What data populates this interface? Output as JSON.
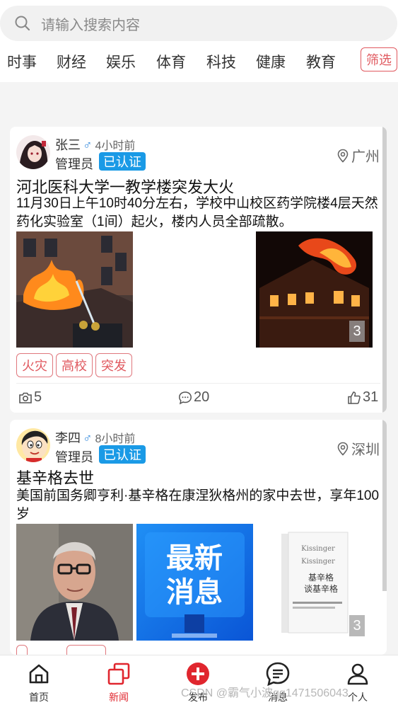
{
  "search": {
    "placeholder": "请输入搜索内容"
  },
  "tabs": [
    "时事",
    "财经",
    "娱乐",
    "体育",
    "科技",
    "健康",
    "教育"
  ],
  "filter_label": "筛选",
  "posts": [
    {
      "user": "张三",
      "gender": "♂",
      "time": "4小时前",
      "role": "管理员",
      "verified": "已认证",
      "location": "广州",
      "title": "河北医科大学一教学楼突发大火",
      "content": "11月30日上午10时40分左右，学校中山校区药学院楼4层天然药化实验室（1间）起火，楼内人员全部疏散。",
      "image_badge": "3",
      "tags": [
        "火灾",
        "高校",
        "突发"
      ],
      "photos": "5",
      "comments": "20",
      "likes": "31"
    },
    {
      "user": "李四",
      "gender": "♂",
      "time": "8小时前",
      "role": "管理员",
      "verified": "已认证",
      "location": "深圳",
      "title": "基辛格去世",
      "content": "美国前国务卿亨利·基辛格在康涅狄格州的家中去世，享年100岁",
      "image_badge": "3",
      "image_texts": {
        "news_line1": "最新",
        "news_line2": "消息",
        "book_title_1": "基辛格",
        "book_title_2": "谈基辛格",
        "book_en": "Kissinger"
      }
    }
  ],
  "bottom_nav": [
    {
      "label": "首页",
      "icon": "home-icon"
    },
    {
      "label": "新闻",
      "icon": "news-icon"
    },
    {
      "label": "发布",
      "icon": "publish-plus-icon"
    },
    {
      "label": "消息",
      "icon": "message-icon"
    },
    {
      "label": "个人",
      "icon": "person-icon"
    }
  ],
  "watermark": "CSDN @霸气小波qq1471506043",
  "colors": {
    "accent_red": "#e0262e",
    "verified_blue": "#1a9ae6",
    "tag_red": "#e0595f"
  }
}
